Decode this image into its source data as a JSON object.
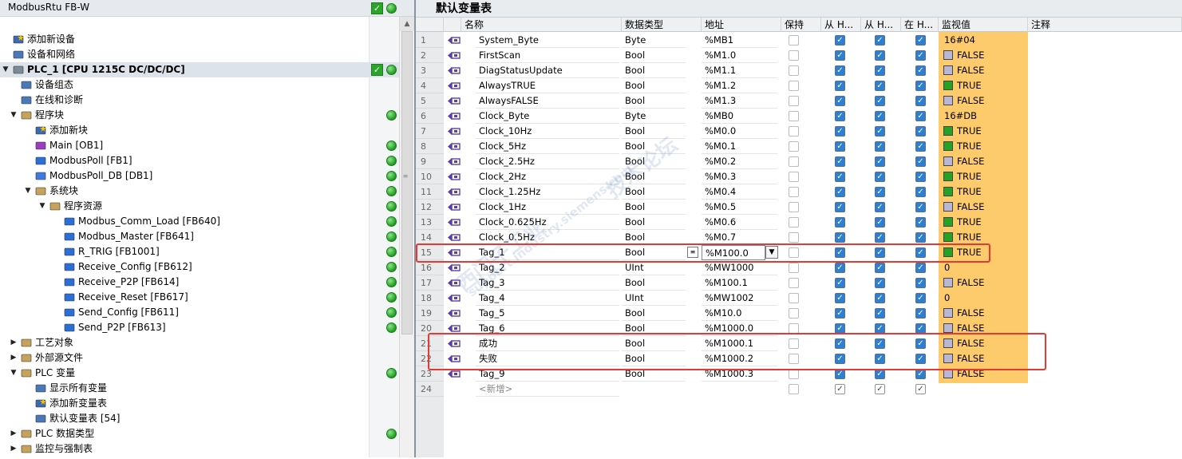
{
  "tree": {
    "project_name": "ModbusRtu FB-W",
    "items": [
      {
        "label": "添加新设备",
        "level": 0,
        "arrow": "",
        "icon": "add-device-icon"
      },
      {
        "label": "设备和网络",
        "level": 0,
        "arrow": "",
        "icon": "network-icon"
      },
      {
        "label": "PLC_1 [CPU 1215C DC/DC/DC]",
        "level": 0,
        "arrow": "▼",
        "icon": "plc-icon"
      },
      {
        "label": "设备组态",
        "level": 1,
        "arrow": "",
        "icon": "device-config-icon"
      },
      {
        "label": "在线和诊断",
        "level": 1,
        "arrow": "",
        "icon": "diagnostics-icon"
      },
      {
        "label": "程序块",
        "level": 1,
        "arrow": "▼",
        "icon": "folder-icon"
      },
      {
        "label": "添加新块",
        "level": 2,
        "arrow": "",
        "icon": "add-block-icon"
      },
      {
        "label": "Main [OB1]",
        "level": 2,
        "arrow": "",
        "icon": "ob-icon"
      },
      {
        "label": "ModbusPoll [FB1]",
        "level": 2,
        "arrow": "",
        "icon": "fb-icon"
      },
      {
        "label": "ModbusPoll_DB [DB1]",
        "level": 2,
        "arrow": "",
        "icon": "db-icon"
      },
      {
        "label": "系统块",
        "level": 2,
        "arrow": "▼",
        "icon": "folder-icon"
      },
      {
        "label": "程序资源",
        "level": 3,
        "arrow": "▼",
        "icon": "folder-icon"
      },
      {
        "label": "Modbus_Comm_Load [FB640]",
        "level": 4,
        "arrow": "",
        "icon": "fb-icon"
      },
      {
        "label": "Modbus_Master [FB641]",
        "level": 4,
        "arrow": "",
        "icon": "fb-icon"
      },
      {
        "label": "R_TRIG [FB1001]",
        "level": 4,
        "arrow": "",
        "icon": "fb-icon"
      },
      {
        "label": "Receive_Config [FB612]",
        "level": 4,
        "arrow": "",
        "icon": "fb-icon"
      },
      {
        "label": "Receive_P2P [FB614]",
        "level": 4,
        "arrow": "",
        "icon": "fb-icon"
      },
      {
        "label": "Receive_Reset [FB617]",
        "level": 4,
        "arrow": "",
        "icon": "fb-icon"
      },
      {
        "label": "Send_Config [FB611]",
        "level": 4,
        "arrow": "",
        "icon": "fb-icon"
      },
      {
        "label": "Send_P2P [FB613]",
        "level": 4,
        "arrow": "",
        "icon": "fb-icon"
      },
      {
        "label": "工艺对象",
        "level": 1,
        "arrow": "▶",
        "icon": "folder-icon"
      },
      {
        "label": "外部源文件",
        "level": 1,
        "arrow": "▶",
        "icon": "folder-icon"
      },
      {
        "label": "PLC 变量",
        "level": 1,
        "arrow": "▼",
        "icon": "folder-icon"
      },
      {
        "label": "显示所有变量",
        "level": 2,
        "arrow": "",
        "icon": "show-tags-icon"
      },
      {
        "label": "添加新变量表",
        "level": 2,
        "arrow": "",
        "icon": "add-tag-table-icon"
      },
      {
        "label": "默认变量表 [54]",
        "level": 2,
        "arrow": "",
        "icon": "tag-table-icon"
      },
      {
        "label": "PLC 数据类型",
        "level": 1,
        "arrow": "▶",
        "icon": "folder-icon"
      },
      {
        "label": "监控与强制表",
        "level": 1,
        "arrow": "▶",
        "icon": "folder-icon"
      }
    ]
  },
  "table": {
    "title": "默认变量表",
    "headers": [
      "名称",
      "数据类型",
      "地址",
      "保持",
      "从 H...",
      "从 H...",
      "在 H...",
      "监视值",
      "注释"
    ],
    "rows": [
      {
        "n": "1",
        "name": "System_Byte",
        "type": "Byte",
        "addr": "%MB1",
        "mon": "16#04",
        "sq": ""
      },
      {
        "n": "2",
        "name": "FirstScan",
        "type": "Bool",
        "addr": "%M1.0",
        "mon": "FALSE",
        "sq": "off"
      },
      {
        "n": "3",
        "name": "DiagStatusUpdate",
        "type": "Bool",
        "addr": "%M1.1",
        "mon": "FALSE",
        "sq": "off"
      },
      {
        "n": "4",
        "name": "AlwaysTRUE",
        "type": "Bool",
        "addr": "%M1.2",
        "mon": "TRUE",
        "sq": "on"
      },
      {
        "n": "5",
        "name": "AlwaysFALSE",
        "type": "Bool",
        "addr": "%M1.3",
        "mon": "FALSE",
        "sq": "off"
      },
      {
        "n": "6",
        "name": "Clock_Byte",
        "type": "Byte",
        "addr": "%MB0",
        "mon": "16#DB",
        "sq": ""
      },
      {
        "n": "7",
        "name": "Clock_10Hz",
        "type": "Bool",
        "addr": "%M0.0",
        "mon": "TRUE",
        "sq": "on"
      },
      {
        "n": "8",
        "name": "Clock_5Hz",
        "type": "Bool",
        "addr": "%M0.1",
        "mon": "TRUE",
        "sq": "on"
      },
      {
        "n": "9",
        "name": "Clock_2.5Hz",
        "type": "Bool",
        "addr": "%M0.2",
        "mon": "FALSE",
        "sq": "off"
      },
      {
        "n": "10",
        "name": "Clock_2Hz",
        "type": "Bool",
        "addr": "%M0.3",
        "mon": "TRUE",
        "sq": "on"
      },
      {
        "n": "11",
        "name": "Clock_1.25Hz",
        "type": "Bool",
        "addr": "%M0.4",
        "mon": "TRUE",
        "sq": "on"
      },
      {
        "n": "12",
        "name": "Clock_1Hz",
        "type": "Bool",
        "addr": "%M0.5",
        "mon": "FALSE",
        "sq": "off"
      },
      {
        "n": "13",
        "name": "Clock_0.625Hz",
        "type": "Bool",
        "addr": "%M0.6",
        "mon": "TRUE",
        "sq": "on"
      },
      {
        "n": "14",
        "name": "Clock_0.5Hz",
        "type": "Bool",
        "addr": "%M0.7",
        "mon": "TRUE",
        "sq": "on"
      },
      {
        "n": "15",
        "name": "Tag_1",
        "type": "Bool",
        "addr": "%M100.0",
        "mon": "TRUE",
        "sq": "on"
      },
      {
        "n": "16",
        "name": "Tag_2",
        "type": "UInt",
        "addr": "%MW1000",
        "mon": "0",
        "sq": ""
      },
      {
        "n": "17",
        "name": "Tag_3",
        "type": "Bool",
        "addr": "%M100.1",
        "mon": "FALSE",
        "sq": "off"
      },
      {
        "n": "18",
        "name": "Tag_4",
        "type": "UInt",
        "addr": "%MW1002",
        "mon": "0",
        "sq": ""
      },
      {
        "n": "19",
        "name": "Tag_5",
        "type": "Bool",
        "addr": "%M10.0",
        "mon": "FALSE",
        "sq": "off"
      },
      {
        "n": "20",
        "name": "Tag_6",
        "type": "Bool",
        "addr": "%M1000.0",
        "mon": "FALSE",
        "sq": "off"
      },
      {
        "n": "21",
        "name": "成功",
        "type": "Bool",
        "addr": "%M1000.1",
        "mon": "FALSE",
        "sq": "off"
      },
      {
        "n": "22",
        "name": "失败",
        "type": "Bool",
        "addr": "%M1000.2",
        "mon": "FALSE",
        "sq": "off"
      },
      {
        "n": "23",
        "name": "Tag_9",
        "type": "Bool",
        "addr": "%M1000.3",
        "mon": "FALSE",
        "sq": "off"
      }
    ],
    "new_row": {
      "n": "24",
      "name": "<新增>"
    }
  },
  "watermarks": [
    "西门子工业",
    "技术论坛",
    "support.industry.siemens.com"
  ],
  "colors": {
    "monitor_bg": "#fdca6c",
    "true_square": "#24a224",
    "false_square": "#b9b6d6",
    "highlight_box": "#e53935",
    "checkbox_on": "#2d7fd2"
  }
}
